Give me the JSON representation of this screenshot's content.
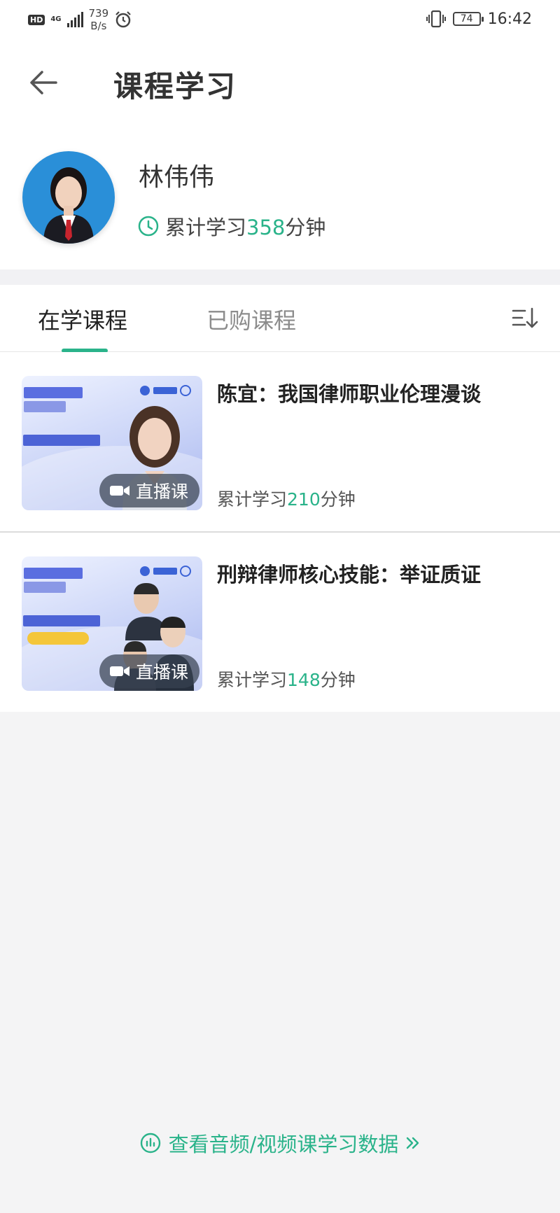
{
  "status_bar": {
    "hd": "HD",
    "network": "4G",
    "speed_value": "739",
    "speed_unit": "B/s",
    "battery": "74",
    "time": "16:42"
  },
  "header": {
    "title": "课程学习"
  },
  "profile": {
    "name": "林伟伟",
    "study_prefix": "累计学习",
    "study_minutes": "358",
    "study_suffix": "分钟"
  },
  "tabs": [
    {
      "label": "在学课程"
    },
    {
      "label": "已购课程"
    }
  ],
  "courses": [
    {
      "title": "陈宜：我国律师职业伦理漫谈",
      "badge": "直播课",
      "study_prefix": "累计学习",
      "study_minutes": "210",
      "study_suffix": "分钟"
    },
    {
      "title": "刑辩律师核心技能：举证质证",
      "badge": "直播课",
      "study_prefix": "累计学习",
      "study_minutes": "148",
      "study_suffix": "分钟"
    }
  ],
  "footer": {
    "link": "查看音频/视频课学习数据"
  },
  "colors": {
    "accent": "#2ab38a",
    "background": "#f4f4f5"
  }
}
